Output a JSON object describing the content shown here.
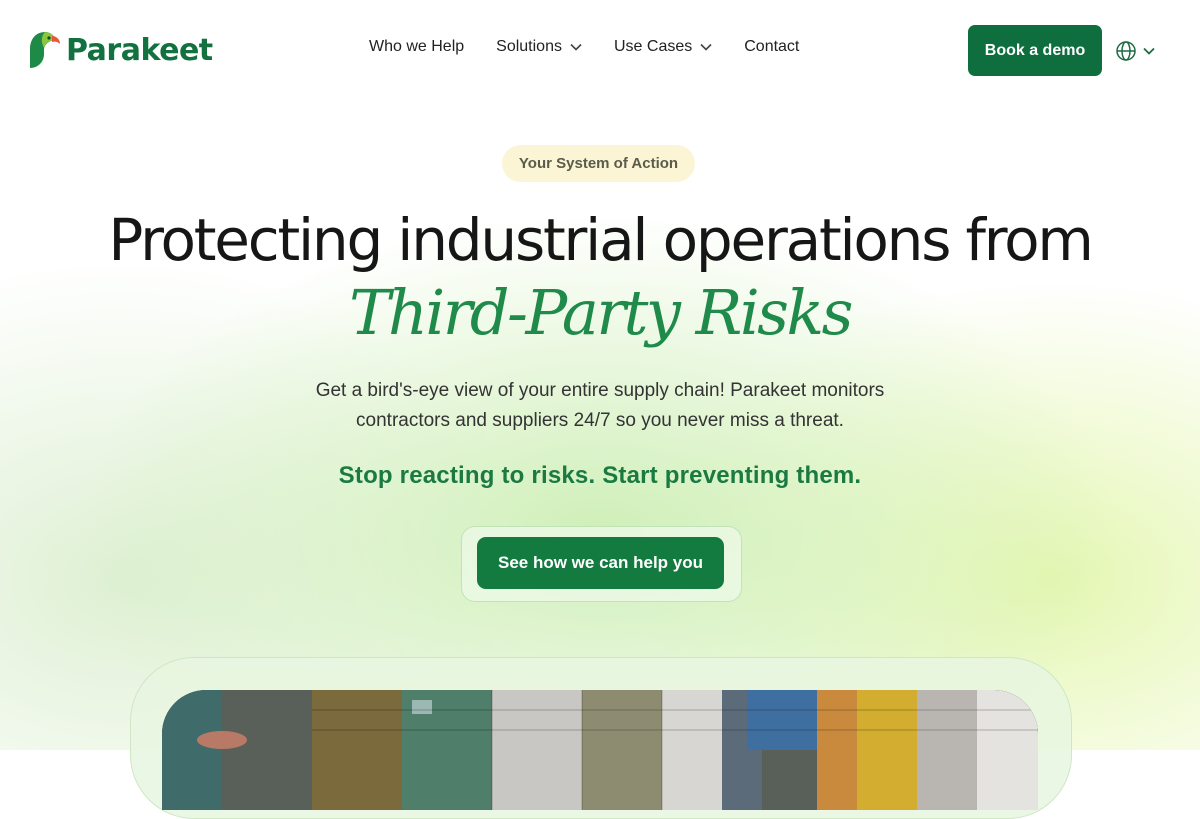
{
  "brand": {
    "name": "Parakeet",
    "color": "#12713f"
  },
  "nav": {
    "items": [
      {
        "label": "Who we Help",
        "dropdown": false
      },
      {
        "label": "Solutions",
        "dropdown": true
      },
      {
        "label": "Use Cases",
        "dropdown": true
      },
      {
        "label": "Contact",
        "dropdown": false
      }
    ]
  },
  "header": {
    "demo_label": "Book a demo",
    "language_icon": "globe-icon"
  },
  "hero": {
    "badge": "Your System of Action",
    "title": "Protecting industrial operations from",
    "title_accent": "Third-Party Risks",
    "description": "Get a bird's-eye view of your entire supply chain! Parakeet monitors contractors and suppliers 24/7 so you never miss a threat.",
    "tagline": "Stop reacting to risks. Start preventing them.",
    "cta_label": "See how we can help you"
  },
  "colors": {
    "accent": "#1f8a4a",
    "button": "#0f6e3e",
    "badge_bg": "#fbf5d6"
  }
}
